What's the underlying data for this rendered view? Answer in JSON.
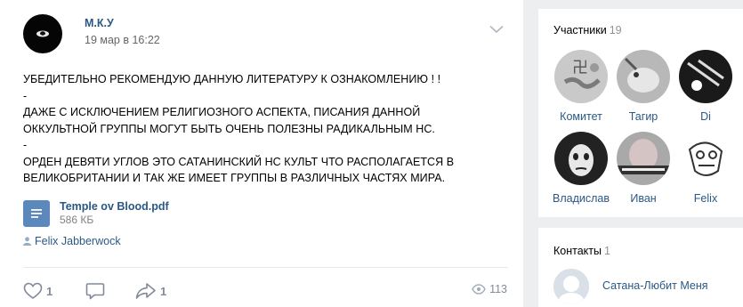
{
  "post": {
    "author": "М.К.У",
    "date": "19 мар в 16:22",
    "lines": [
      "УБЕДИТЕЛЬНО РЕКОМЕНДУЮ ДАННУЮ ЛИТЕРАТУРУ К ОЗНАКОМЛЕНИЮ ! !",
      "-",
      "ДАЖЕ С ИСКЛЮЧЕНИЕМ РЕЛИГИОЗНОГО АСПЕКТА, ПИСАНИЯ ДАННОЙ",
      "ОККУЛЬТНОЙ ГРУППЫ МОГУТ БЫТЬ ОЧЕНЬ ПОЛЕЗНЫ РАДИКАЛЬНЫМ НС.",
      "-",
      "ОРДЕН ДЕВЯТИ УГЛОВ ЭТО САТАНИНСКИЙ НС КУЛЬТ ЧТО РАСПОЛАГАЕТСЯ В",
      "ВЕЛИКОБРИТАНИИ И ТАК ЖЕ ИМЕЕТ ГРУППЫ В РАЗЛИЧНЫХ ЧАСТЯХ МИРА."
    ],
    "attachment": {
      "name": "Temple ov Blood.pdf",
      "size": "586 КБ"
    },
    "signer": "Felix Jabberwock",
    "likes": "1",
    "shares": "1",
    "views": "113"
  },
  "members": {
    "title": "Участники",
    "count": "19",
    "items": [
      {
        "name": "Комитет"
      },
      {
        "name": "Тагир"
      },
      {
        "name": "Di"
      },
      {
        "name": "Владислав"
      },
      {
        "name": "Иван"
      },
      {
        "name": "Felix"
      }
    ]
  },
  "contacts": {
    "title": "Контакты",
    "count": "1",
    "items": [
      {
        "name": "Сатана-Любит Меня"
      }
    ]
  },
  "colors": {
    "link": "#2a5885",
    "background": "#edeef0",
    "muted": "#828a99",
    "doc": "#5b88bd"
  }
}
